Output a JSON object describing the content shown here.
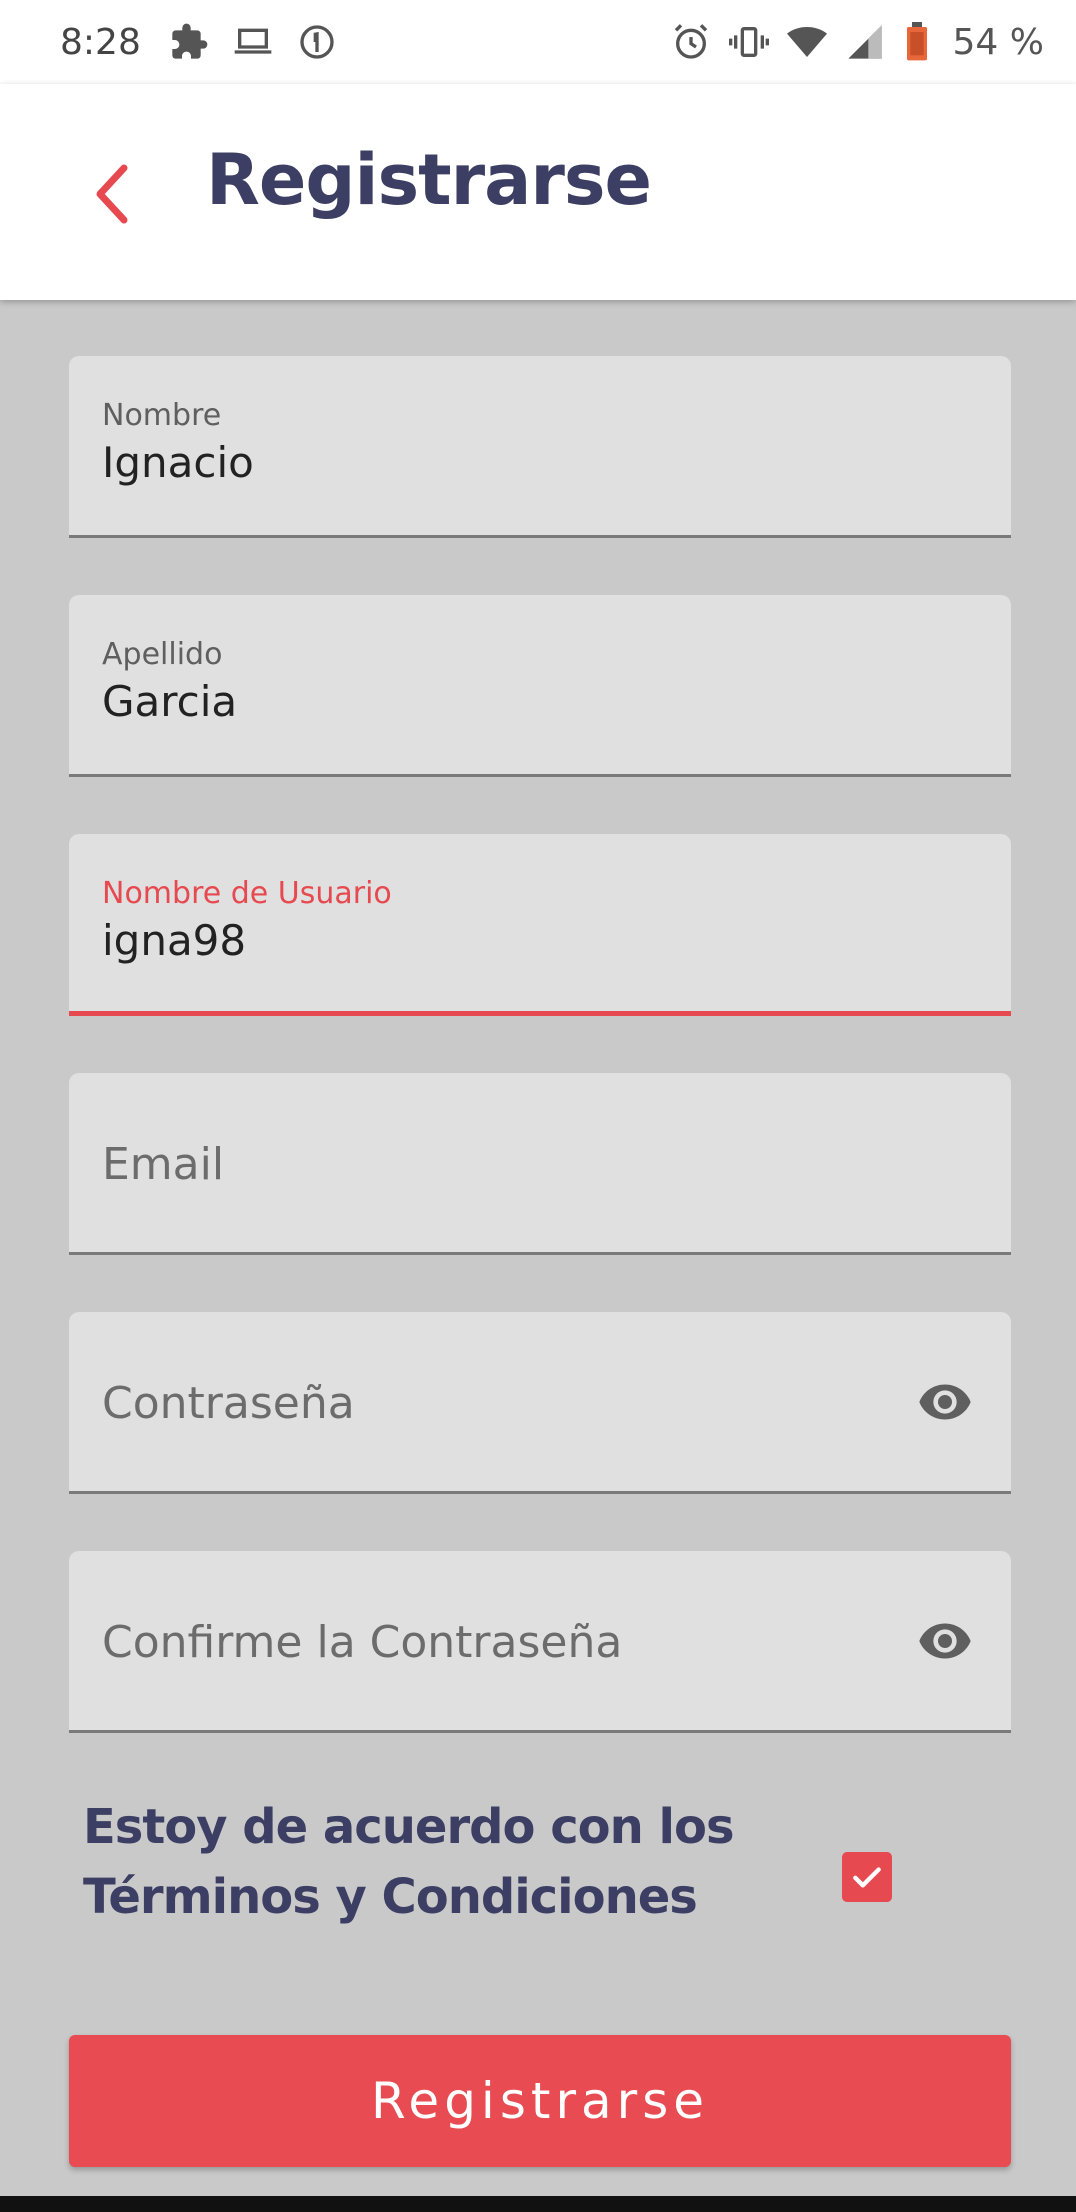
{
  "status_bar": {
    "time": "8:28",
    "battery": "54 %",
    "left_icons": [
      "puzzle-icon",
      "laptop-icon",
      "food-icon"
    ],
    "right_icons": [
      "alarm-icon",
      "vibrate-icon",
      "wifi-icon",
      "signal-icon",
      "battery-icon"
    ]
  },
  "app_bar": {
    "title": "Registrarse",
    "back_icon": "chevron-left-icon"
  },
  "form": {
    "nombre": {
      "label": "Nombre",
      "value": "Ignacio"
    },
    "apellido": {
      "label": "Apellido",
      "value": "Garcia"
    },
    "usuario": {
      "label": "Nombre de Usuario",
      "value": "igna98"
    },
    "email": {
      "placeholder": "Email",
      "value": ""
    },
    "password": {
      "placeholder": "Contraseña",
      "value": ""
    },
    "confirm_password": {
      "placeholder": "Confirme la Contraseña",
      "value": ""
    },
    "terms": {
      "line1": "Estoy de acuerdo con los",
      "line2": "Términos y Condiciones",
      "checked": true
    },
    "submit_label": "Registrarse"
  },
  "colors": {
    "accent": "#e84b51",
    "title": "#3c3f63",
    "background": "#c9c9c9",
    "field": "#e0e0e0"
  }
}
